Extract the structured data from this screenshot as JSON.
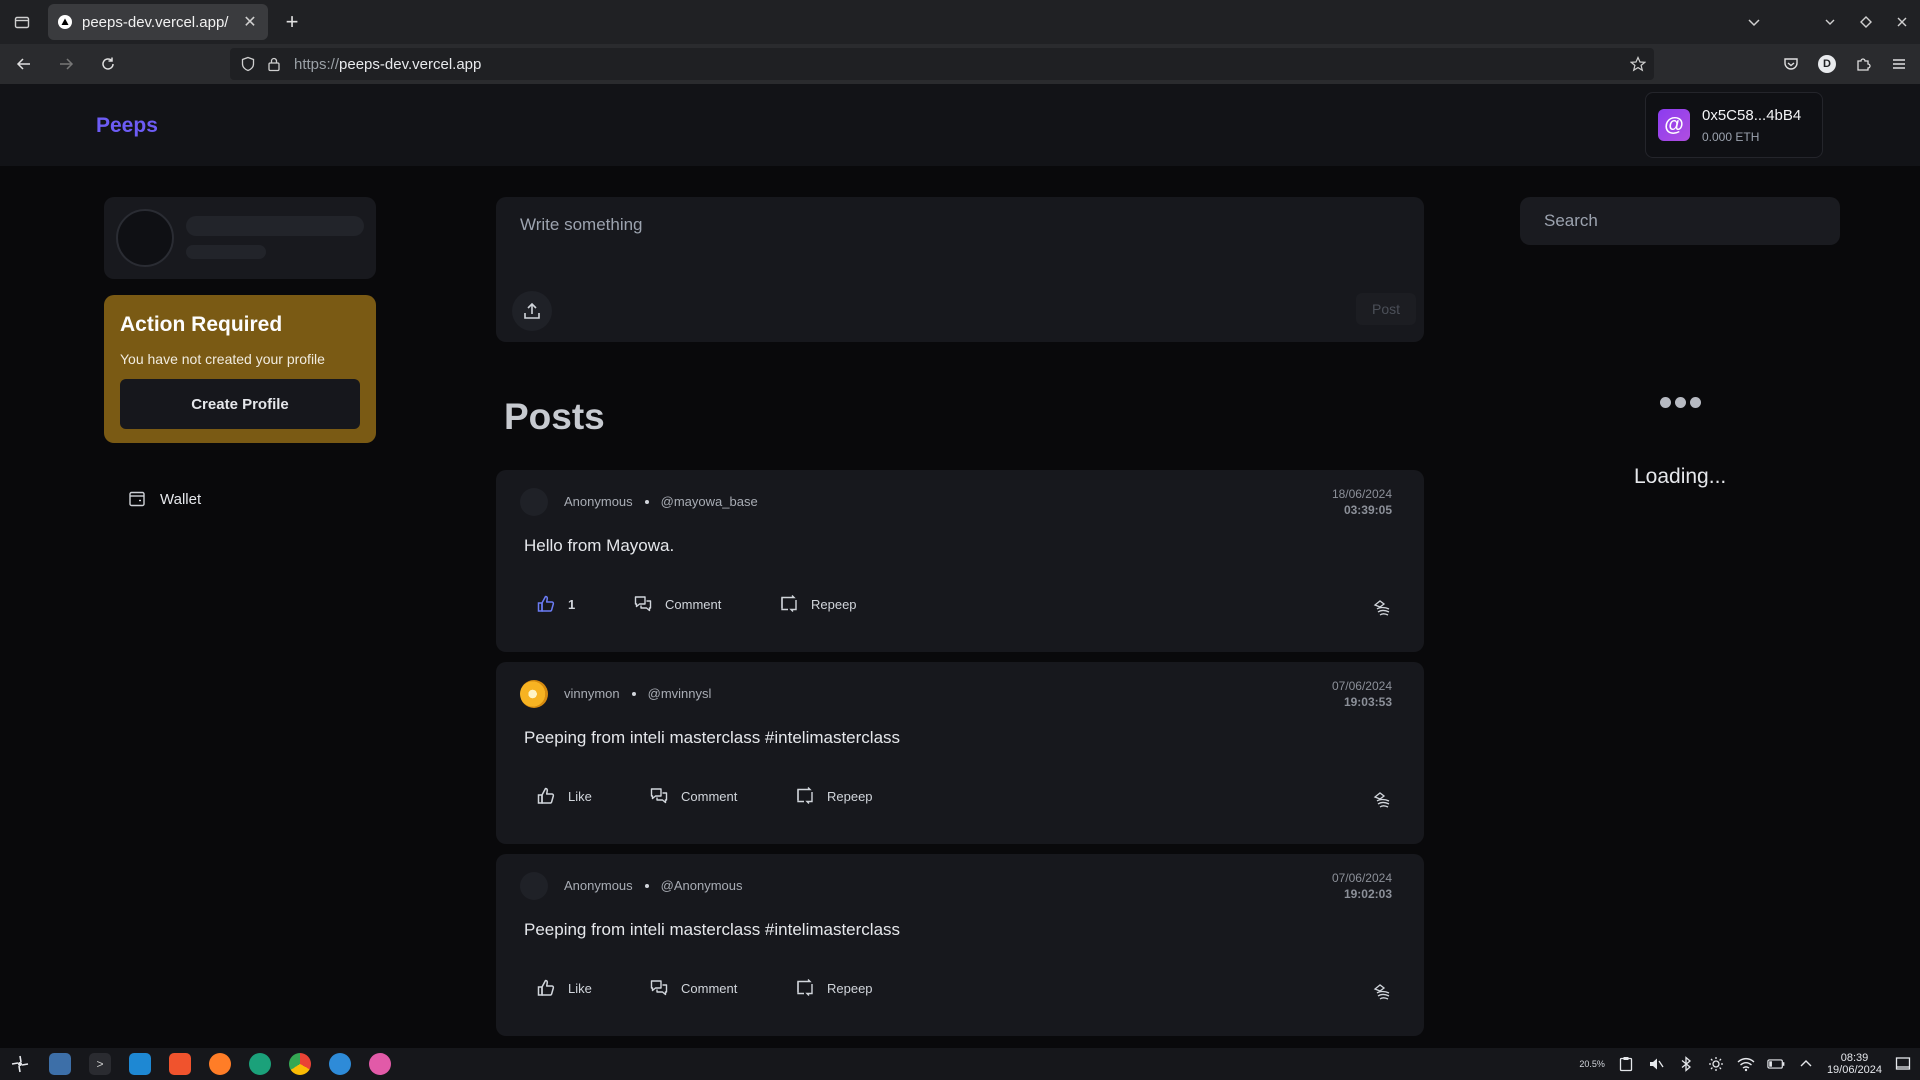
{
  "browser": {
    "tab_title": "peeps-dev.vercel.app/",
    "tab_close": "✕",
    "new_tab": "+",
    "url_prefix": "https://",
    "url_host": "peeps-dev.vercel.app",
    "profile_initial": "D"
  },
  "app": {
    "logo": "Peeps",
    "wallet": {
      "address": "0x5C58...4bB4",
      "balance": "0.000 ETH",
      "badge": "@"
    }
  },
  "sidebar": {
    "action_card": {
      "title": "Action Required",
      "message": "You have not created your profile",
      "button": "Create Profile"
    },
    "links": [
      {
        "label": "Wallet",
        "icon": "wallet-icon"
      }
    ]
  },
  "composer": {
    "placeholder": "Write something",
    "post_button": "Post"
  },
  "feed": {
    "title": "Posts",
    "posts": [
      {
        "author": "Anonymous",
        "handle": "@mayowa_base",
        "date": "18/06/2024",
        "time": "03:39:05",
        "text": "Hello from Mayowa.",
        "like_label": "1",
        "comment_label": "Comment",
        "repeep_label": "Repeep"
      },
      {
        "author": "vinnymon",
        "handle": "@mvinnysl",
        "date": "07/06/2024",
        "time": "19:03:53",
        "text": "Peeping from inteli masterclass #intelimasterclass",
        "like_label": "Like",
        "comment_label": "Comment",
        "repeep_label": "Repeep"
      },
      {
        "author": "Anonymous",
        "handle": "@Anonymous",
        "date": "07/06/2024",
        "time": "19:02:03",
        "text": "Peeping from inteli masterclass #intelimasterclass",
        "like_label": "Like",
        "comment_label": "Comment",
        "repeep_label": "Repeep"
      }
    ]
  },
  "right_panel": {
    "search_placeholder": "Search",
    "loading_text": "Loading..."
  },
  "taskbar": {
    "time": "08:39",
    "date": "19/06/2024",
    "battery_label": "20.5%"
  },
  "colors": {
    "brand": "#6d5cf5",
    "action_card": "#7a5a14",
    "like_active": "#6b7cf5"
  }
}
